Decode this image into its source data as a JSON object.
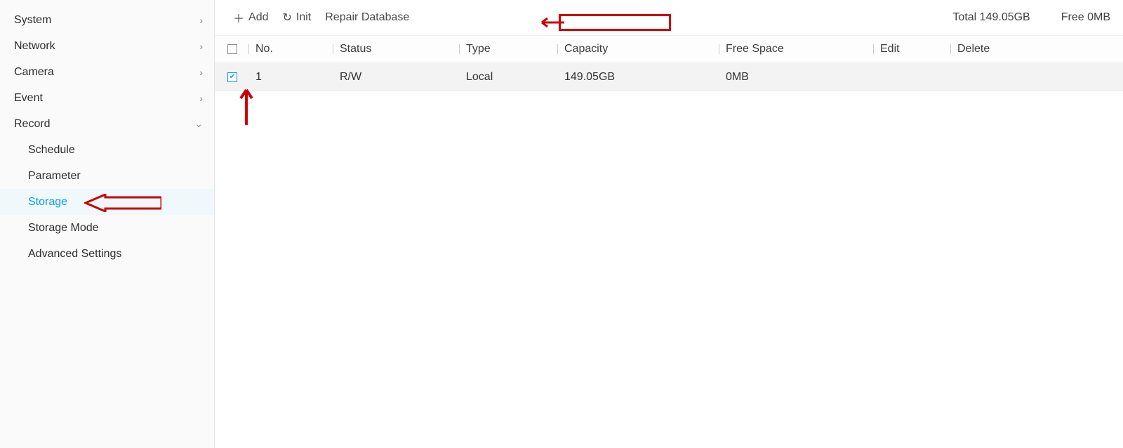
{
  "sidebar": {
    "items": [
      {
        "label": "System",
        "type": "menu"
      },
      {
        "label": "Network",
        "type": "menu"
      },
      {
        "label": "Camera",
        "type": "menu"
      },
      {
        "label": "Event",
        "type": "menu"
      },
      {
        "label": "Record",
        "type": "menu-open"
      }
    ],
    "record_sub": [
      {
        "label": "Schedule"
      },
      {
        "label": "Parameter"
      },
      {
        "label": "Storage",
        "active": true
      },
      {
        "label": "Storage Mode"
      },
      {
        "label": "Advanced Settings"
      }
    ]
  },
  "toolbar": {
    "add": "Add",
    "init": "Init",
    "repair": "Repair Database",
    "total_label": "Total",
    "total_value": "149.05GB",
    "free_label": "Free",
    "free_value": "0MB"
  },
  "table": {
    "headers": {
      "no": "No.",
      "status": "Status",
      "type": "Type",
      "capacity": "Capacity",
      "free": "Free Space",
      "edit": "Edit",
      "delete": "Delete"
    },
    "rows": [
      {
        "checked": true,
        "no": "1",
        "status": "R/W",
        "type": "Local",
        "capacity": "149.05GB",
        "free": "0MB"
      }
    ]
  }
}
